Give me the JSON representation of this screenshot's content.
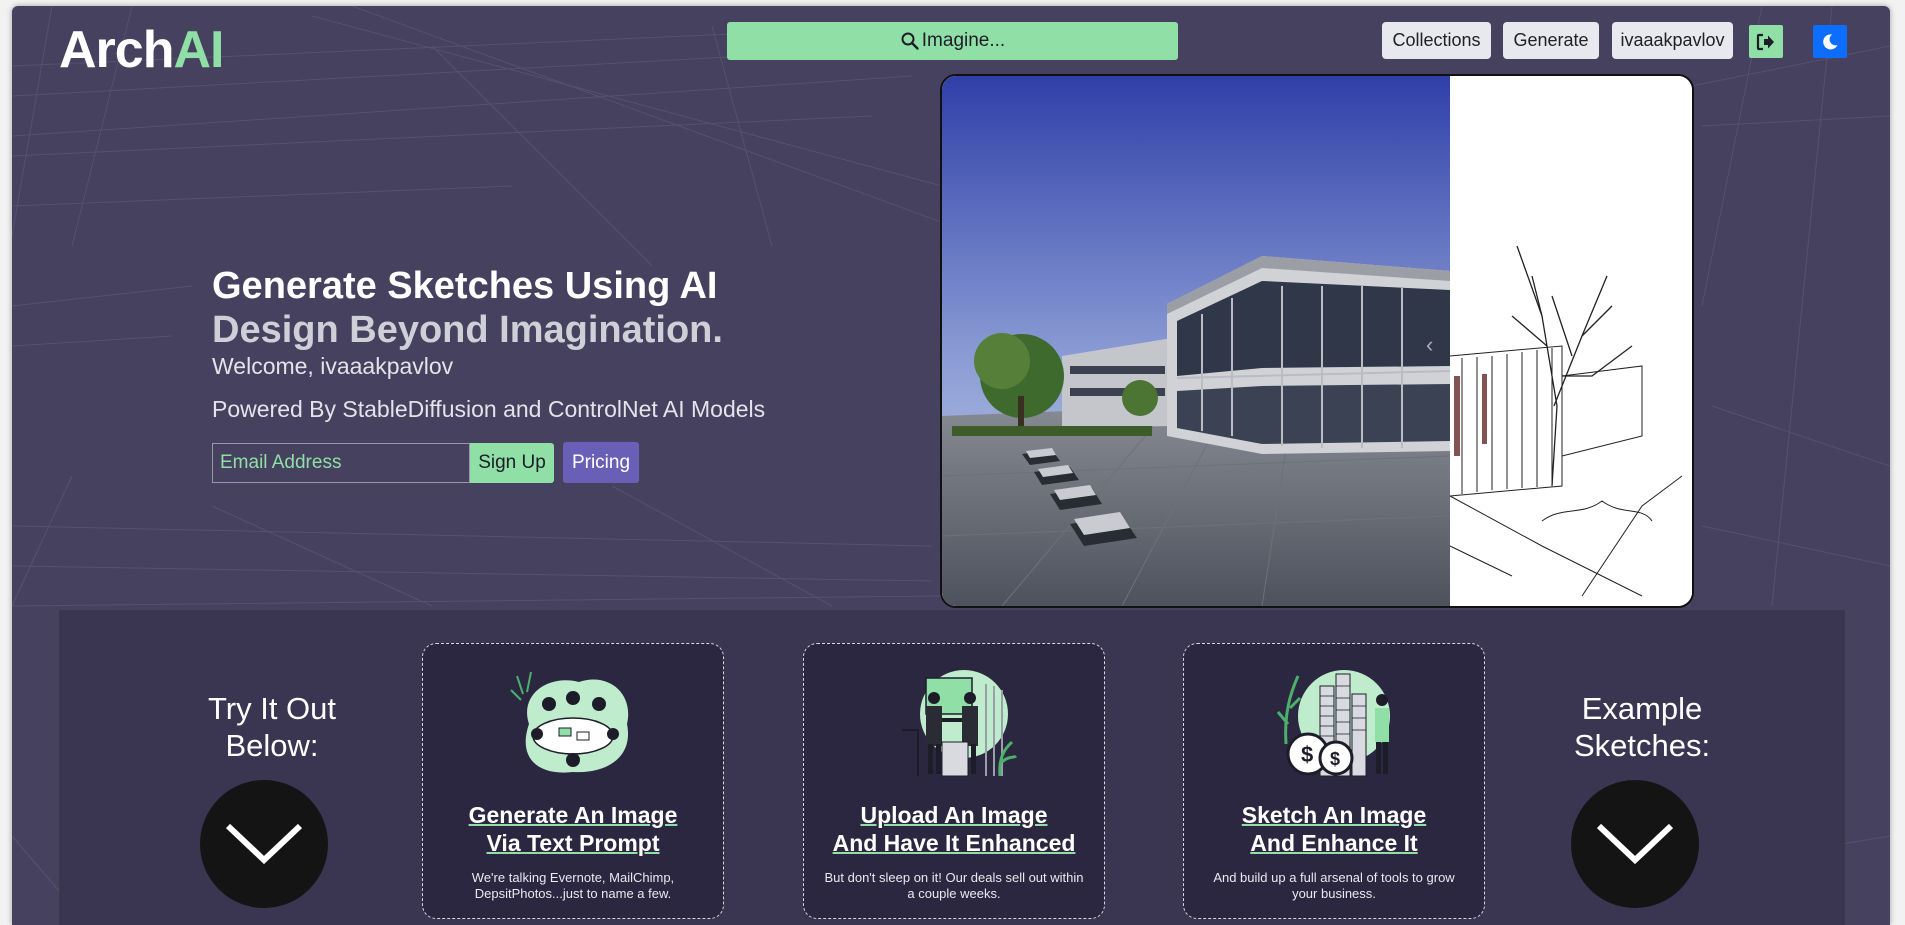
{
  "header": {
    "logo_part1": "Arch",
    "logo_part2": "AI",
    "search_label": "Imagine...",
    "nav": [
      "Collections",
      "Generate",
      "ivaaakpavlov"
    ],
    "logout_icon": "sign-out-icon",
    "theme_icon": "moon-icon"
  },
  "hero": {
    "title": "Generate Sketches Using AI",
    "subtitle": "Design Beyond Imagination.",
    "welcome": "Welcome, ivaaakpavlov",
    "powered": "Powered By StableDiffusion and ControlNet AI Models",
    "email_placeholder": "Email Address",
    "signup_label": "Sign Up",
    "pricing_label": "Pricing"
  },
  "carousel": {
    "prev_icon": "chevron-left-icon",
    "next_icon": "chevron-right-icon"
  },
  "panel": {
    "left_title": "Try It Out Below:",
    "right_title": "Example Sketches:",
    "cards": [
      {
        "title_line1": "Generate An Image",
        "title_line2": "Via Text Prompt",
        "desc": "We're talking Evernote, MailChimp, DepsitPhotos...just to name a few."
      },
      {
        "title_line1": "Upload An Image",
        "title_line2": "And Have It Enhanced",
        "desc": "But don't sleep on it! Our deals sell out within a couple weeks."
      },
      {
        "title_line1": "Sketch An Image",
        "title_line2": "And Enhance It",
        "desc": "And build up a full arsenal of tools to grow your business."
      }
    ]
  },
  "colors": {
    "background": "#46415e",
    "accent_green": "#8fdfa6",
    "pricing_purple": "#6a5fb6",
    "theme_blue": "#0d6efd"
  }
}
